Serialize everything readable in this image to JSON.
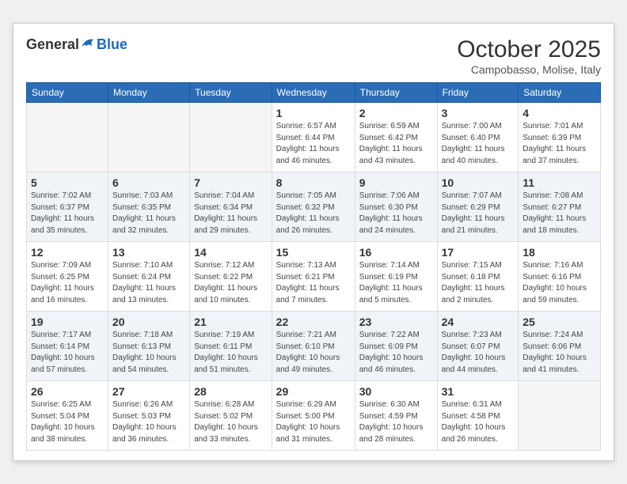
{
  "header": {
    "logo_general": "General",
    "logo_blue": "Blue",
    "month_title": "October 2025",
    "subtitle": "Campobasso, Molise, Italy"
  },
  "columns": [
    "Sunday",
    "Monday",
    "Tuesday",
    "Wednesday",
    "Thursday",
    "Friday",
    "Saturday"
  ],
  "weeks": [
    {
      "row_class": "row-odd",
      "days": [
        {
          "number": "",
          "info": ""
        },
        {
          "number": "",
          "info": ""
        },
        {
          "number": "",
          "info": ""
        },
        {
          "number": "1",
          "info": "Sunrise: 6:57 AM\nSunset: 6:44 PM\nDaylight: 11 hours and 46 minutes."
        },
        {
          "number": "2",
          "info": "Sunrise: 6:59 AM\nSunset: 6:42 PM\nDaylight: 11 hours and 43 minutes."
        },
        {
          "number": "3",
          "info": "Sunrise: 7:00 AM\nSunset: 6:40 PM\nDaylight: 11 hours and 40 minutes."
        },
        {
          "number": "4",
          "info": "Sunrise: 7:01 AM\nSunset: 6:39 PM\nDaylight: 11 hours and 37 minutes."
        }
      ]
    },
    {
      "row_class": "row-even",
      "days": [
        {
          "number": "5",
          "info": "Sunrise: 7:02 AM\nSunset: 6:37 PM\nDaylight: 11 hours and 35 minutes."
        },
        {
          "number": "6",
          "info": "Sunrise: 7:03 AM\nSunset: 6:35 PM\nDaylight: 11 hours and 32 minutes."
        },
        {
          "number": "7",
          "info": "Sunrise: 7:04 AM\nSunset: 6:34 PM\nDaylight: 11 hours and 29 minutes."
        },
        {
          "number": "8",
          "info": "Sunrise: 7:05 AM\nSunset: 6:32 PM\nDaylight: 11 hours and 26 minutes."
        },
        {
          "number": "9",
          "info": "Sunrise: 7:06 AM\nSunset: 6:30 PM\nDaylight: 11 hours and 24 minutes."
        },
        {
          "number": "10",
          "info": "Sunrise: 7:07 AM\nSunset: 6:29 PM\nDaylight: 11 hours and 21 minutes."
        },
        {
          "number": "11",
          "info": "Sunrise: 7:08 AM\nSunset: 6:27 PM\nDaylight: 11 hours and 18 minutes."
        }
      ]
    },
    {
      "row_class": "row-odd",
      "days": [
        {
          "number": "12",
          "info": "Sunrise: 7:09 AM\nSunset: 6:25 PM\nDaylight: 11 hours and 16 minutes."
        },
        {
          "number": "13",
          "info": "Sunrise: 7:10 AM\nSunset: 6:24 PM\nDaylight: 11 hours and 13 minutes."
        },
        {
          "number": "14",
          "info": "Sunrise: 7:12 AM\nSunset: 6:22 PM\nDaylight: 11 hours and 10 minutes."
        },
        {
          "number": "15",
          "info": "Sunrise: 7:13 AM\nSunset: 6:21 PM\nDaylight: 11 hours and 7 minutes."
        },
        {
          "number": "16",
          "info": "Sunrise: 7:14 AM\nSunset: 6:19 PM\nDaylight: 11 hours and 5 minutes."
        },
        {
          "number": "17",
          "info": "Sunrise: 7:15 AM\nSunset: 6:18 PM\nDaylight: 11 hours and 2 minutes."
        },
        {
          "number": "18",
          "info": "Sunrise: 7:16 AM\nSunset: 6:16 PM\nDaylight: 10 hours and 59 minutes."
        }
      ]
    },
    {
      "row_class": "row-even",
      "days": [
        {
          "number": "19",
          "info": "Sunrise: 7:17 AM\nSunset: 6:14 PM\nDaylight: 10 hours and 57 minutes."
        },
        {
          "number": "20",
          "info": "Sunrise: 7:18 AM\nSunset: 6:13 PM\nDaylight: 10 hours and 54 minutes."
        },
        {
          "number": "21",
          "info": "Sunrise: 7:19 AM\nSunset: 6:11 PM\nDaylight: 10 hours and 51 minutes."
        },
        {
          "number": "22",
          "info": "Sunrise: 7:21 AM\nSunset: 6:10 PM\nDaylight: 10 hours and 49 minutes."
        },
        {
          "number": "23",
          "info": "Sunrise: 7:22 AM\nSunset: 6:09 PM\nDaylight: 10 hours and 46 minutes."
        },
        {
          "number": "24",
          "info": "Sunrise: 7:23 AM\nSunset: 6:07 PM\nDaylight: 10 hours and 44 minutes."
        },
        {
          "number": "25",
          "info": "Sunrise: 7:24 AM\nSunset: 6:06 PM\nDaylight: 10 hours and 41 minutes."
        }
      ]
    },
    {
      "row_class": "row-odd",
      "days": [
        {
          "number": "26",
          "info": "Sunrise: 6:25 AM\nSunset: 5:04 PM\nDaylight: 10 hours and 38 minutes."
        },
        {
          "number": "27",
          "info": "Sunrise: 6:26 AM\nSunset: 5:03 PM\nDaylight: 10 hours and 36 minutes."
        },
        {
          "number": "28",
          "info": "Sunrise: 6:28 AM\nSunset: 5:02 PM\nDaylight: 10 hours and 33 minutes."
        },
        {
          "number": "29",
          "info": "Sunrise: 6:29 AM\nSunset: 5:00 PM\nDaylight: 10 hours and 31 minutes."
        },
        {
          "number": "30",
          "info": "Sunrise: 6:30 AM\nSunset: 4:59 PM\nDaylight: 10 hours and 28 minutes."
        },
        {
          "number": "31",
          "info": "Sunrise: 6:31 AM\nSunset: 4:58 PM\nDaylight: 10 hours and 26 minutes."
        },
        {
          "number": "",
          "info": ""
        }
      ]
    }
  ]
}
